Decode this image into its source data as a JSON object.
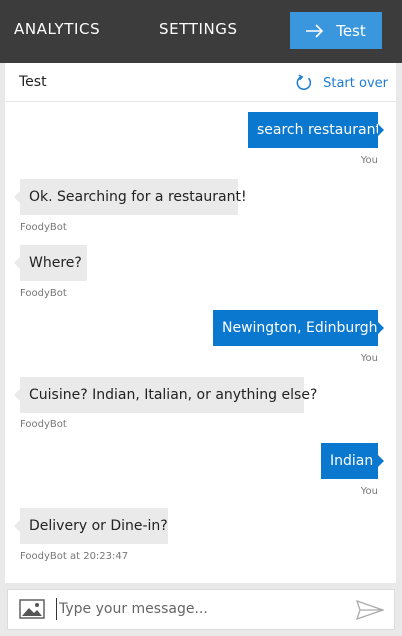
{
  "nav": {
    "analytics": "ANALYTICS",
    "settings": "SETTINGS",
    "test_button": "Test"
  },
  "panel": {
    "title": "Test",
    "start_over": "Start over"
  },
  "messages": [
    {
      "sender": "user",
      "text": "search restaurant",
      "meta": "You"
    },
    {
      "sender": "bot",
      "text": "Ok. Searching for a restaurant!",
      "meta": "FoodyBot"
    },
    {
      "sender": "bot",
      "text": "Where?",
      "meta": "FoodyBot"
    },
    {
      "sender": "user",
      "text": "Newington, Edinburgh",
      "meta": "You"
    },
    {
      "sender": "bot",
      "text": "Cuisine? Indian, Italian, or anything else?",
      "meta": "FoodyBot"
    },
    {
      "sender": "user",
      "text": "Indian",
      "meta": "You"
    },
    {
      "sender": "bot",
      "text": "Delivery or Dine-in?",
      "meta": "FoodyBot at 20:23:47"
    }
  ],
  "composer": {
    "placeholder": "Type your message..."
  },
  "colors": {
    "topbar": "#3c3c3c",
    "accent": "#3a96dd",
    "user_bubble": "#0b78d0",
    "bot_bubble": "#eaeaea",
    "link": "#1c7cd5"
  },
  "icons": {
    "test_button": "arrow-right-icon",
    "start_over": "refresh-icon",
    "attach": "image-icon",
    "send": "send-icon"
  }
}
